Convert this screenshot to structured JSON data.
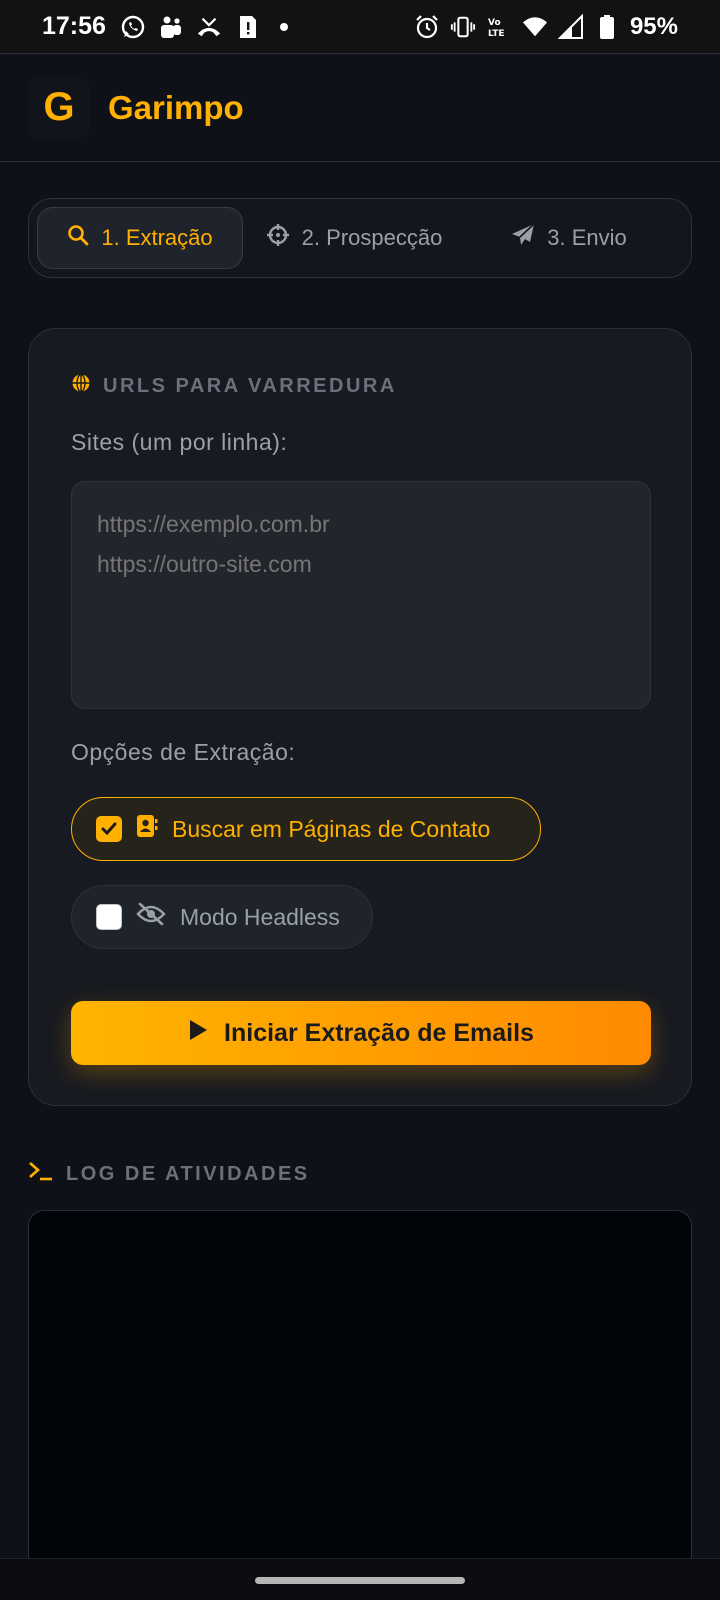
{
  "status_bar": {
    "time": "17:56",
    "battery_percent": "95%"
  },
  "app": {
    "logo_letter": "G",
    "title": "Garimpo",
    "accent_color": "#ffb000"
  },
  "tabs": [
    {
      "label": "1. Extração",
      "icon": "search-icon",
      "active": true
    },
    {
      "label": "2. Prospecção",
      "icon": "crosshair-icon",
      "active": false
    },
    {
      "label": "3. Envio",
      "icon": "paper-plane-icon",
      "active": false
    }
  ],
  "card": {
    "section_title": "URLS PARA VARREDURA",
    "sites_label": "Sites (um por linha):",
    "sites_placeholder": "https://exemplo.com.br\nhttps://outro-site.com",
    "options_label": "Opções de Extração:",
    "options": [
      {
        "label": "Buscar em Páginas de Contato",
        "checked": true,
        "icon": "contact-card-icon"
      },
      {
        "label": "Modo Headless",
        "checked": false,
        "icon": "eye-slash-icon"
      }
    ],
    "start_button": "Iniciar Extração de Emails"
  },
  "log": {
    "title": "LOG DE ATIVIDADES"
  }
}
